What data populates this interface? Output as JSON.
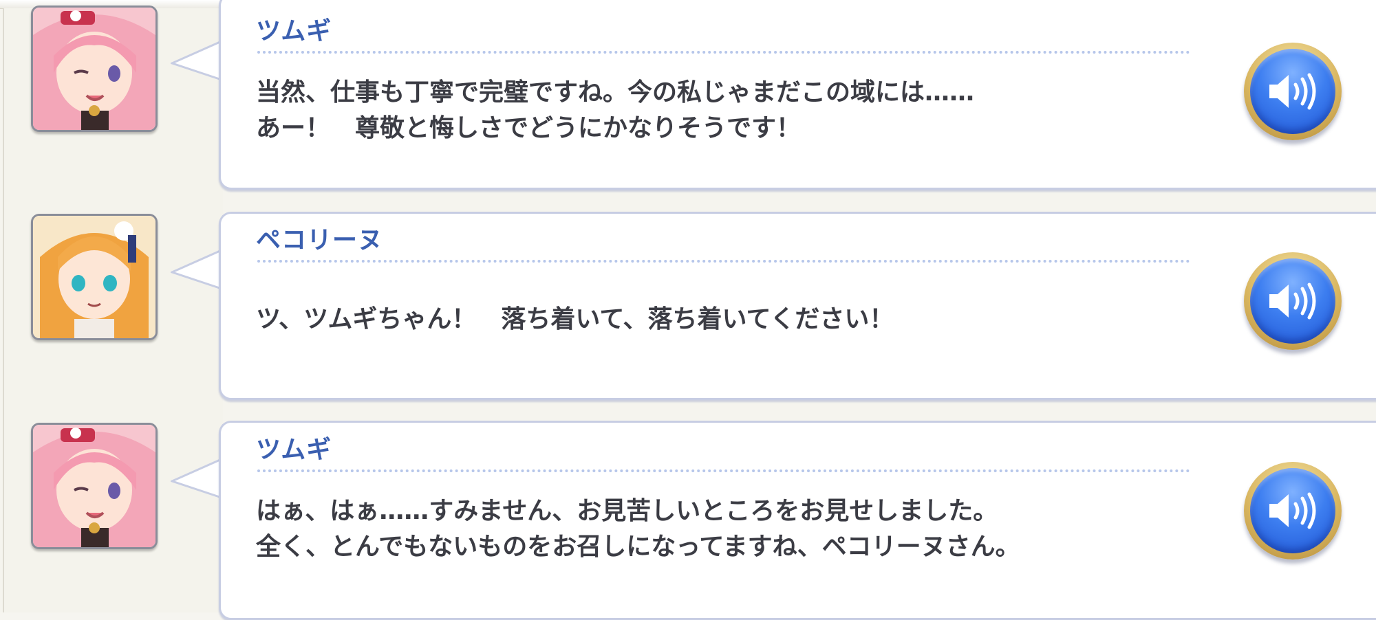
{
  "log": {
    "entries": [
      {
        "speaker": "ツムギ",
        "lines": [
          "当然、仕事も丁寧で完璧ですね。今の私じゃまだこの域には……",
          "あー！　尊敬と悔しさでどうにかなりそうです！"
        ],
        "portrait_icon": "tsumugi-portrait"
      },
      {
        "speaker": "ペコリーヌ",
        "lines": [
          "ツ、ツムギちゃん！　落ち着いて、落ち着いてください！"
        ],
        "portrait_icon": "pecorine-portrait"
      },
      {
        "speaker": "ツムギ",
        "lines": [
          "はぁ、はぁ……すみません、お見苦しいところをお見せしました。",
          "全く、とんでもないものをお召しになってますね、ペコリーヌさん。"
        ],
        "portrait_icon": "tsumugi-portrait"
      }
    ],
    "voice_icon": "speaker-icon"
  },
  "colors": {
    "speaker_name": "#3a5fb0",
    "dialogue_text": "#3b3c44",
    "voice_button": "#3d7ef0",
    "voice_ring": "#d9b660"
  }
}
